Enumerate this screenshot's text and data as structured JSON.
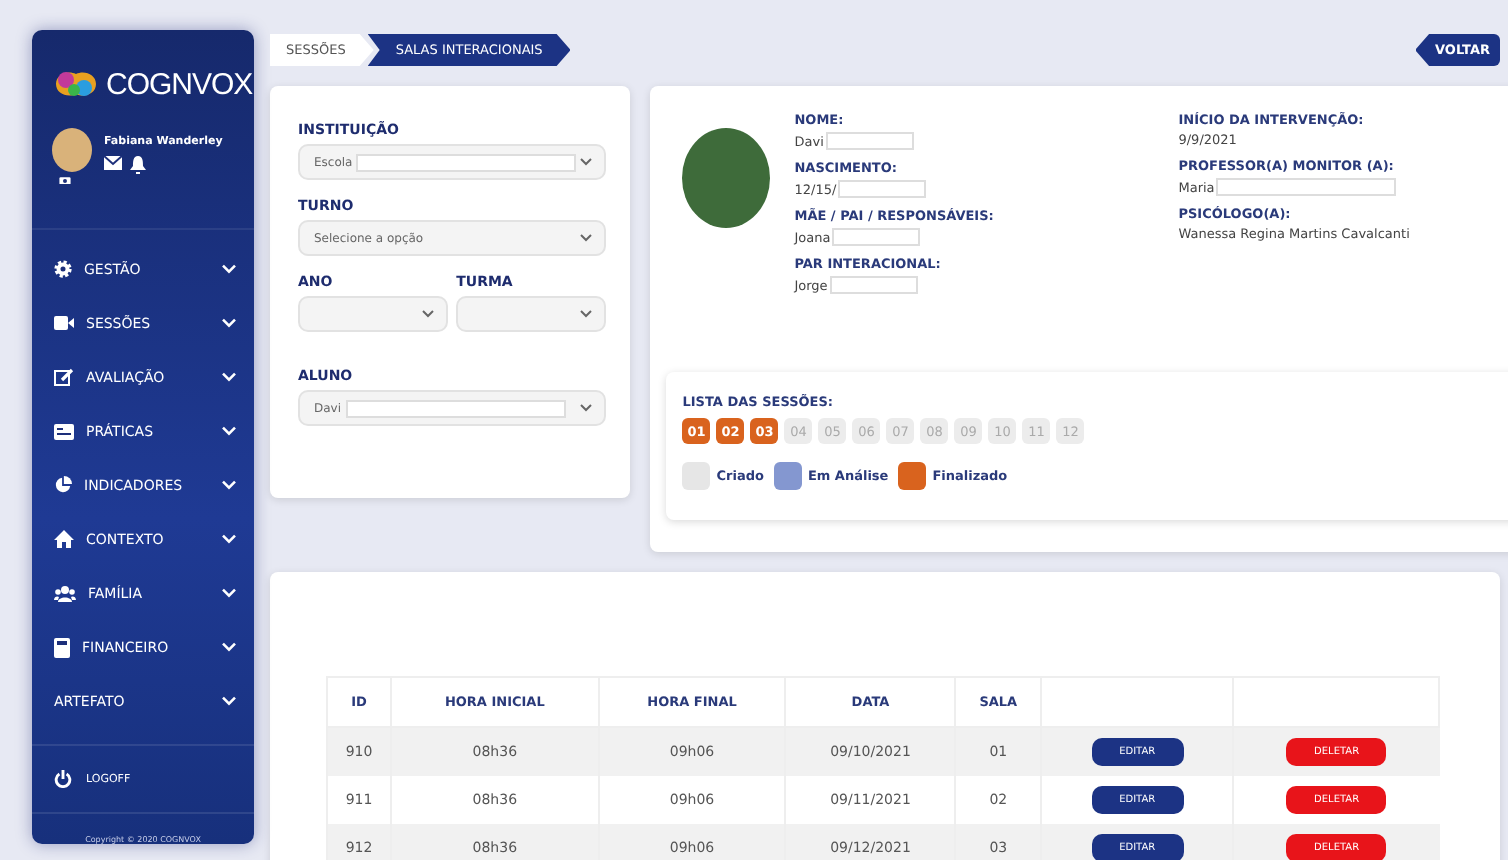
{
  "sidebar": {
    "logo": "COGNVOX",
    "user": {
      "name": "Fabiana Wanderley"
    },
    "menu": [
      {
        "label": "GESTÃO",
        "kind": "gear"
      },
      {
        "label": "SESSÕES",
        "kind": "video"
      },
      {
        "label": "AVALIAÇÃO",
        "kind": "edit"
      },
      {
        "label": "PRÁTICAS",
        "kind": "card"
      },
      {
        "label": "INDICADORES",
        "kind": "pie"
      },
      {
        "label": "CONTEXTO",
        "kind": "home"
      },
      {
        "label": "FAMÍLIA",
        "kind": "users"
      },
      {
        "label": "FINANCEIRO",
        "kind": "calc"
      },
      {
        "label": "ARTEFATO",
        "kind": "plain"
      }
    ],
    "logoff": "LOGOFF",
    "copyright": "Copyright © 2020 COGNVOX"
  },
  "breadcrumb": [
    {
      "label": "SESSÕES",
      "selected": false
    },
    {
      "label": "SALAS INTERACIONAIS",
      "selected": true
    }
  ],
  "back_button": "VOLTAR",
  "filters": [
    {
      "label": "INSTITUIÇÃO",
      "value": "Escola",
      "redacted": true,
      "kind": "full"
    },
    {
      "label": "TURNO",
      "placeholder": "Selecione a opção",
      "kind": "full"
    },
    {
      "label": "ANO",
      "kind": "half"
    },
    {
      "label": "TURMA",
      "kind": "half"
    },
    {
      "label": "ALUNO",
      "value": "Davi",
      "redacted": true,
      "kind": "full"
    }
  ],
  "student": {
    "left": [
      {
        "label": "NOME:",
        "value": "Davi",
        "redacted": true
      },
      {
        "label": "NASCIMENTO:",
        "value": "12/15/",
        "redacted": true
      },
      {
        "label": "MÃE / PAI / RESPONSÁVEIS:",
        "value": "Joana",
        "redacted": true
      },
      {
        "label": "PAR INTERACIONAL:",
        "value": "Jorge",
        "redacted": true
      }
    ],
    "right": [
      {
        "label": "INÍCIO DA INTERVENÇÃO:",
        "value": "9/9/2021"
      },
      {
        "label": "PROFESSOR(A) MONITOR (A):",
        "value": "Maria",
        "redacted": true
      },
      {
        "label": "PSICÓLOGO(A):",
        "value": "Wanessa Regina Martins Cavalcanti"
      }
    ]
  },
  "sessions": {
    "title": "LISTA DAS SESSÕES:",
    "items": [
      {
        "number": "01",
        "kind": "finalizado"
      },
      {
        "number": "02",
        "kind": "finalizado"
      },
      {
        "number": "03",
        "kind": "finalizado"
      },
      {
        "number": "04",
        "kind": "criado"
      },
      {
        "number": "05",
        "kind": "criado"
      },
      {
        "number": "06",
        "kind": "criado"
      },
      {
        "number": "07",
        "kind": "criado"
      },
      {
        "number": "08",
        "kind": "criado"
      },
      {
        "number": "09",
        "kind": "criado"
      },
      {
        "number": "10",
        "kind": "criado"
      },
      {
        "number": "11",
        "kind": "criado"
      },
      {
        "number": "12",
        "kind": "criado"
      }
    ],
    "legend": [
      {
        "label": "Criado",
        "color": "#e6e6e6"
      },
      {
        "label": "Em Análise",
        "color": "#8497d0"
      },
      {
        "label": "Finalizado",
        "color": "#d9631e"
      }
    ]
  },
  "table": {
    "columns": [
      "ID",
      "HORA INICIAL",
      "HORA FINAL",
      "DATA",
      "SALA",
      "",
      ""
    ],
    "rows": [
      {
        "id": "910",
        "start": "08h36",
        "end": "09h06",
        "date": "09/10/2021",
        "room": "01",
        "edit": "EDITAR",
        "delete": "DELETAR"
      },
      {
        "id": "911",
        "start": "08h36",
        "end": "09h06",
        "date": "09/11/2021",
        "room": "02",
        "edit": "EDITAR",
        "delete": "DELETAR"
      },
      {
        "id": "912",
        "start": "08h36",
        "end": "09h06",
        "date": "09/12/2021",
        "room": "03",
        "edit": "EDITAR",
        "delete": "DELETAR"
      }
    ]
  }
}
